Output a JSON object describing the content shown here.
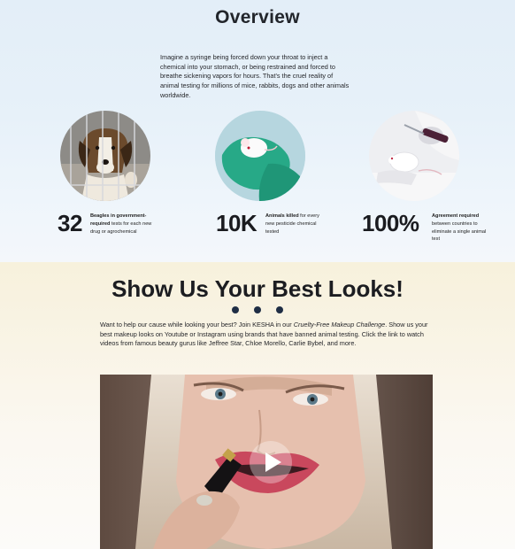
{
  "overview": {
    "title": "Overview",
    "intro": "Imagine a syringe being forced down your throat to inject a chemical into your stomach, or being restrained and forced to breathe sickening vapors for hours. That's the cruel reality of animal testing for millions of mice, rabbits, dogs and other animals worldwide.",
    "stats": [
      {
        "number": "32",
        "label_bold": "Beagles in government-required",
        "label_rest": " tests for each new drug or agrochemical"
      },
      {
        "number": "10K",
        "label_bold": "Animals killed",
        "label_rest": " for every new pesticide chemical tested"
      },
      {
        "number": "100%",
        "label_bold": "Agreement required",
        "label_rest": " between countries to eliminate a single animal test"
      }
    ],
    "images": [
      "beagle-in-cage",
      "mouse-in-gloved-hand",
      "mouse-with-syringe"
    ]
  },
  "looks": {
    "title": "Show Us Your Best Looks!",
    "desc_before": "Want to help our cause while looking your best? Join KESHA in our ",
    "desc_italic": "Cruelty-Free Makeup Challenge",
    "desc_after": ". Show us your best makeup looks on Youtube or Instagram using brands that have banned animal testing. Click the link to watch videos from famous beauty gurus like Jeffree Star, Chloe Morello, Carlie Bybel, and more."
  },
  "video": {
    "thumbnail": "woman-applying-lipstick",
    "play_icon": "play-icon"
  },
  "colors": {
    "overview_bg": "#e5eff8",
    "looks_bg": "#f8f2de",
    "dot": "#1f2e45"
  }
}
